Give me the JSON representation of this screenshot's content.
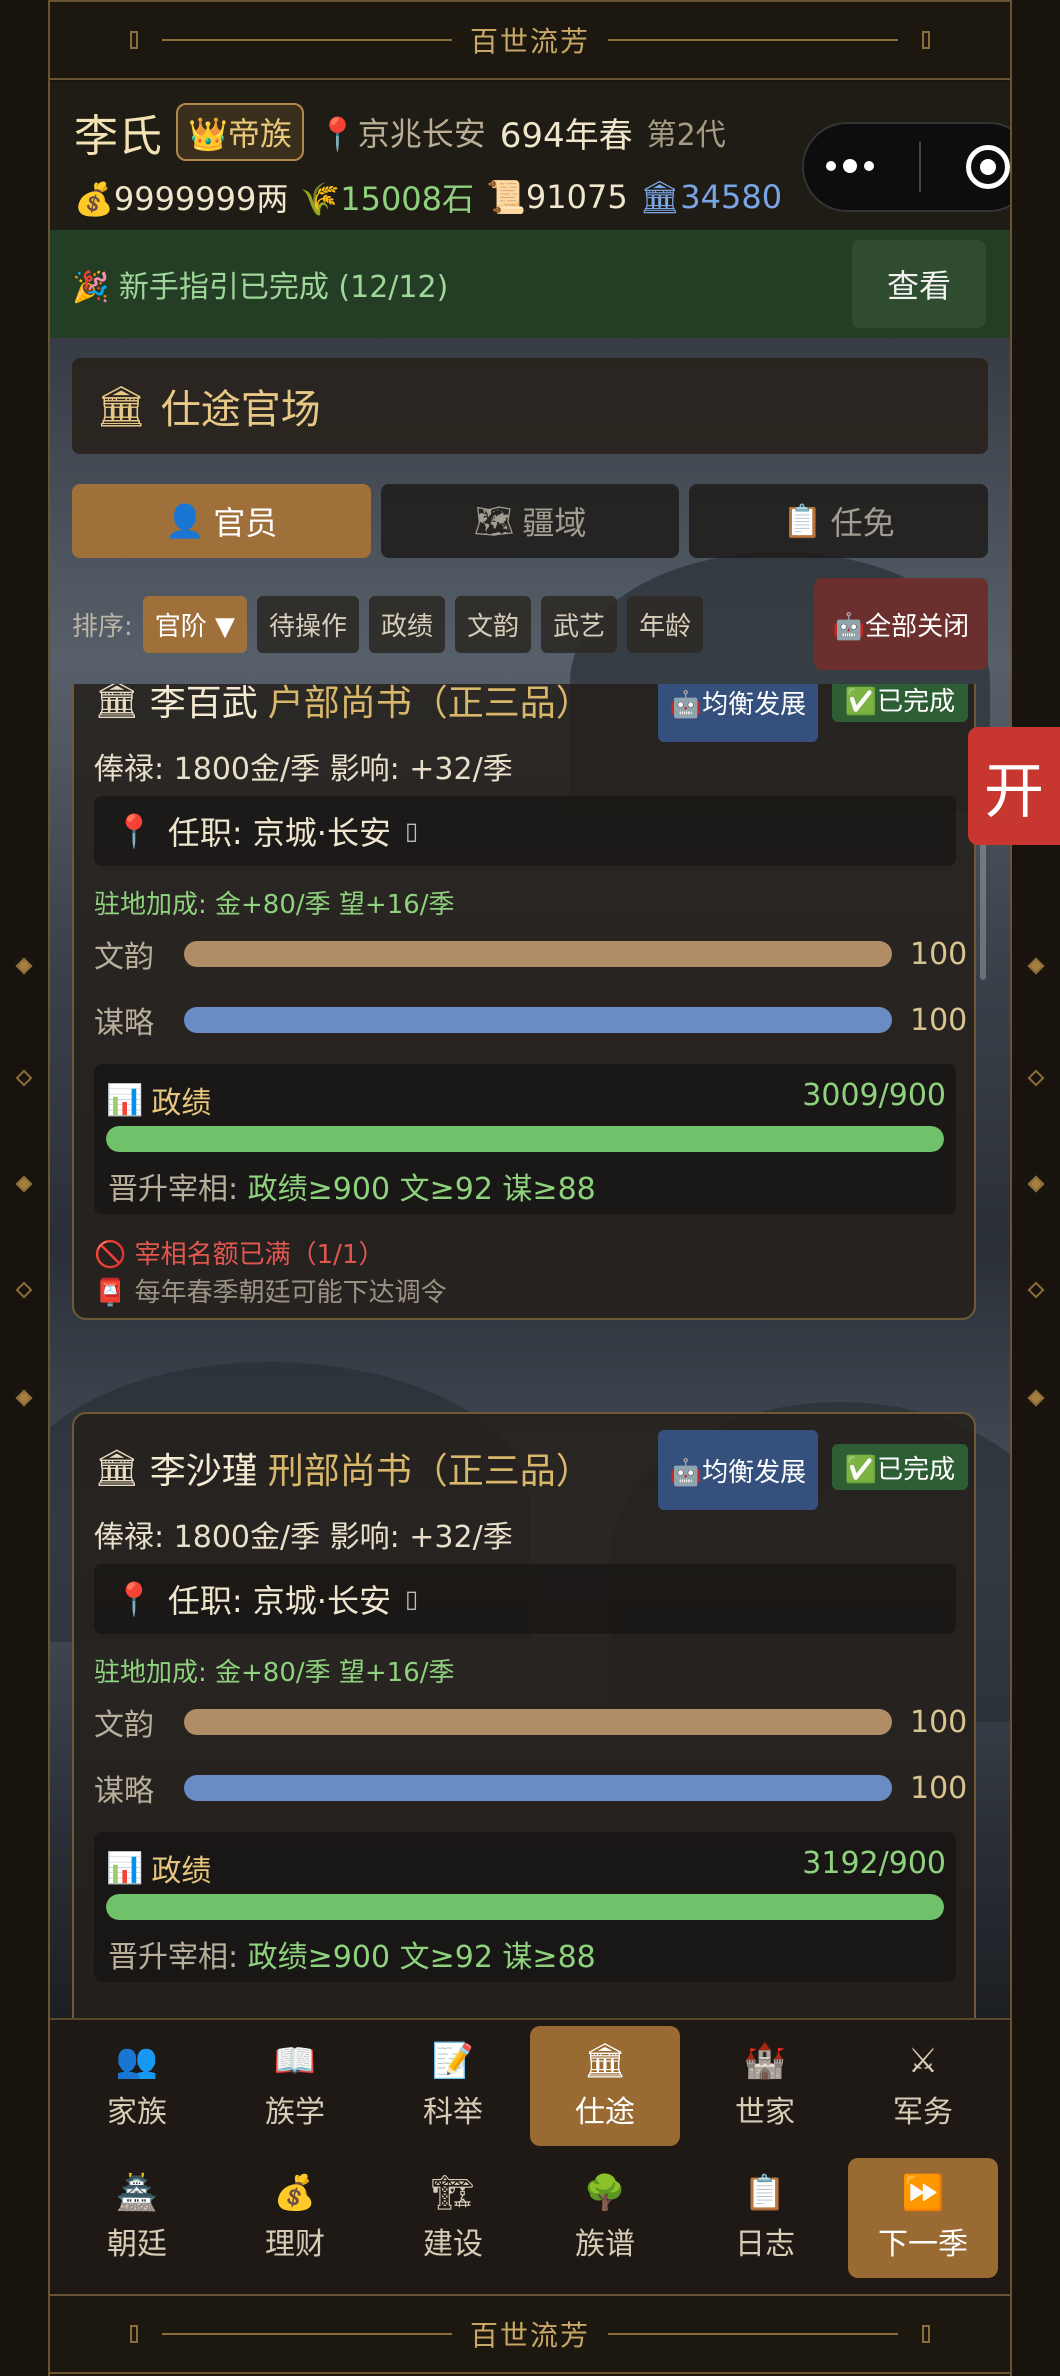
{
  "banner": {
    "title": "百世流芳"
  },
  "header": {
    "name": "李氏",
    "rank_badge": "👑帝族",
    "location": "京兆长安",
    "year": "694年春",
    "generation": "第2代",
    "money": "9999999两",
    "grain": "15008石",
    "scrolls": "91075",
    "prestige": "34580"
  },
  "guide": {
    "text": "🎉 新手指引已完成 (12/12)",
    "button": "查看"
  },
  "section": {
    "title": "仕途官场"
  },
  "tabs": [
    {
      "icon": "👤",
      "label": "官员"
    },
    {
      "icon": "🗺",
      "label": "疆域"
    },
    {
      "icon": "📋",
      "label": "任免"
    }
  ],
  "sort": {
    "label": "排序:",
    "options": [
      "官阶 ▼",
      "待操作",
      "政绩",
      "文韵",
      "武艺",
      "年龄"
    ],
    "close_all": "🤖全部关闭"
  },
  "side_button": "开",
  "officials": [
    {
      "name": "李百武",
      "post": "户部尚书（正三品）",
      "strategy_tag": "🤖均衡发展",
      "status_tag": "✅已完成",
      "salary": "俸禄: 1800金/季   影响: +32/季",
      "station": "任职: 京城·长安",
      "bonus": "驻地加成: 金+80/季  望+16/季",
      "wenyun_label": "文韵",
      "wenyun": "100",
      "moulue_label": "谋略",
      "moulue": "100",
      "perf_label": "政绩",
      "perf_value": "3009/900",
      "perf_ratio": 1.0,
      "promo_label": "晋升宰相:",
      "promo_req": "政绩≥900  文≥92  谋≥88",
      "warning": "🚫 宰相名额已满（1/1）",
      "note": "📮 每年春季朝廷可能下达调令"
    },
    {
      "name": "李沙瑾",
      "post": "刑部尚书（正三品）",
      "strategy_tag": "🤖均衡发展",
      "status_tag": "✅已完成",
      "salary": "俸禄: 1800金/季   影响: +32/季",
      "station": "任职: 京城·长安",
      "bonus": "驻地加成: 金+80/季  望+16/季",
      "wenyun_label": "文韵",
      "wenyun": "100",
      "moulue_label": "谋略",
      "moulue": "100",
      "perf_label": "政绩",
      "perf_value": "3192/900",
      "perf_ratio": 1.0,
      "promo_label": "晋升宰相:",
      "promo_req": "政绩≥900  文≥92  谋≥88"
    }
  ],
  "nav": [
    {
      "icon": "👥",
      "label": "家族"
    },
    {
      "icon": "📖",
      "label": "族学"
    },
    {
      "icon": "📝",
      "label": "科举"
    },
    {
      "icon": "🏛",
      "label": "仕途"
    },
    {
      "icon": "🏰",
      "label": "世家"
    },
    {
      "icon": "⚔",
      "label": "军务"
    },
    {
      "icon": "🏯",
      "label": "朝廷"
    },
    {
      "icon": "💰",
      "label": "理财"
    },
    {
      "icon": "🏗",
      "label": "建设"
    },
    {
      "icon": "🌳",
      "label": "族谱"
    },
    {
      "icon": "📋",
      "label": "日志"
    },
    {
      "icon": "⏩",
      "label": "下一季"
    }
  ],
  "colors": {
    "accent": "#a0703a",
    "green": "#6fc26a",
    "wenyun_bar": "#b08d66",
    "moulue_bar": "#6a8cc4"
  }
}
